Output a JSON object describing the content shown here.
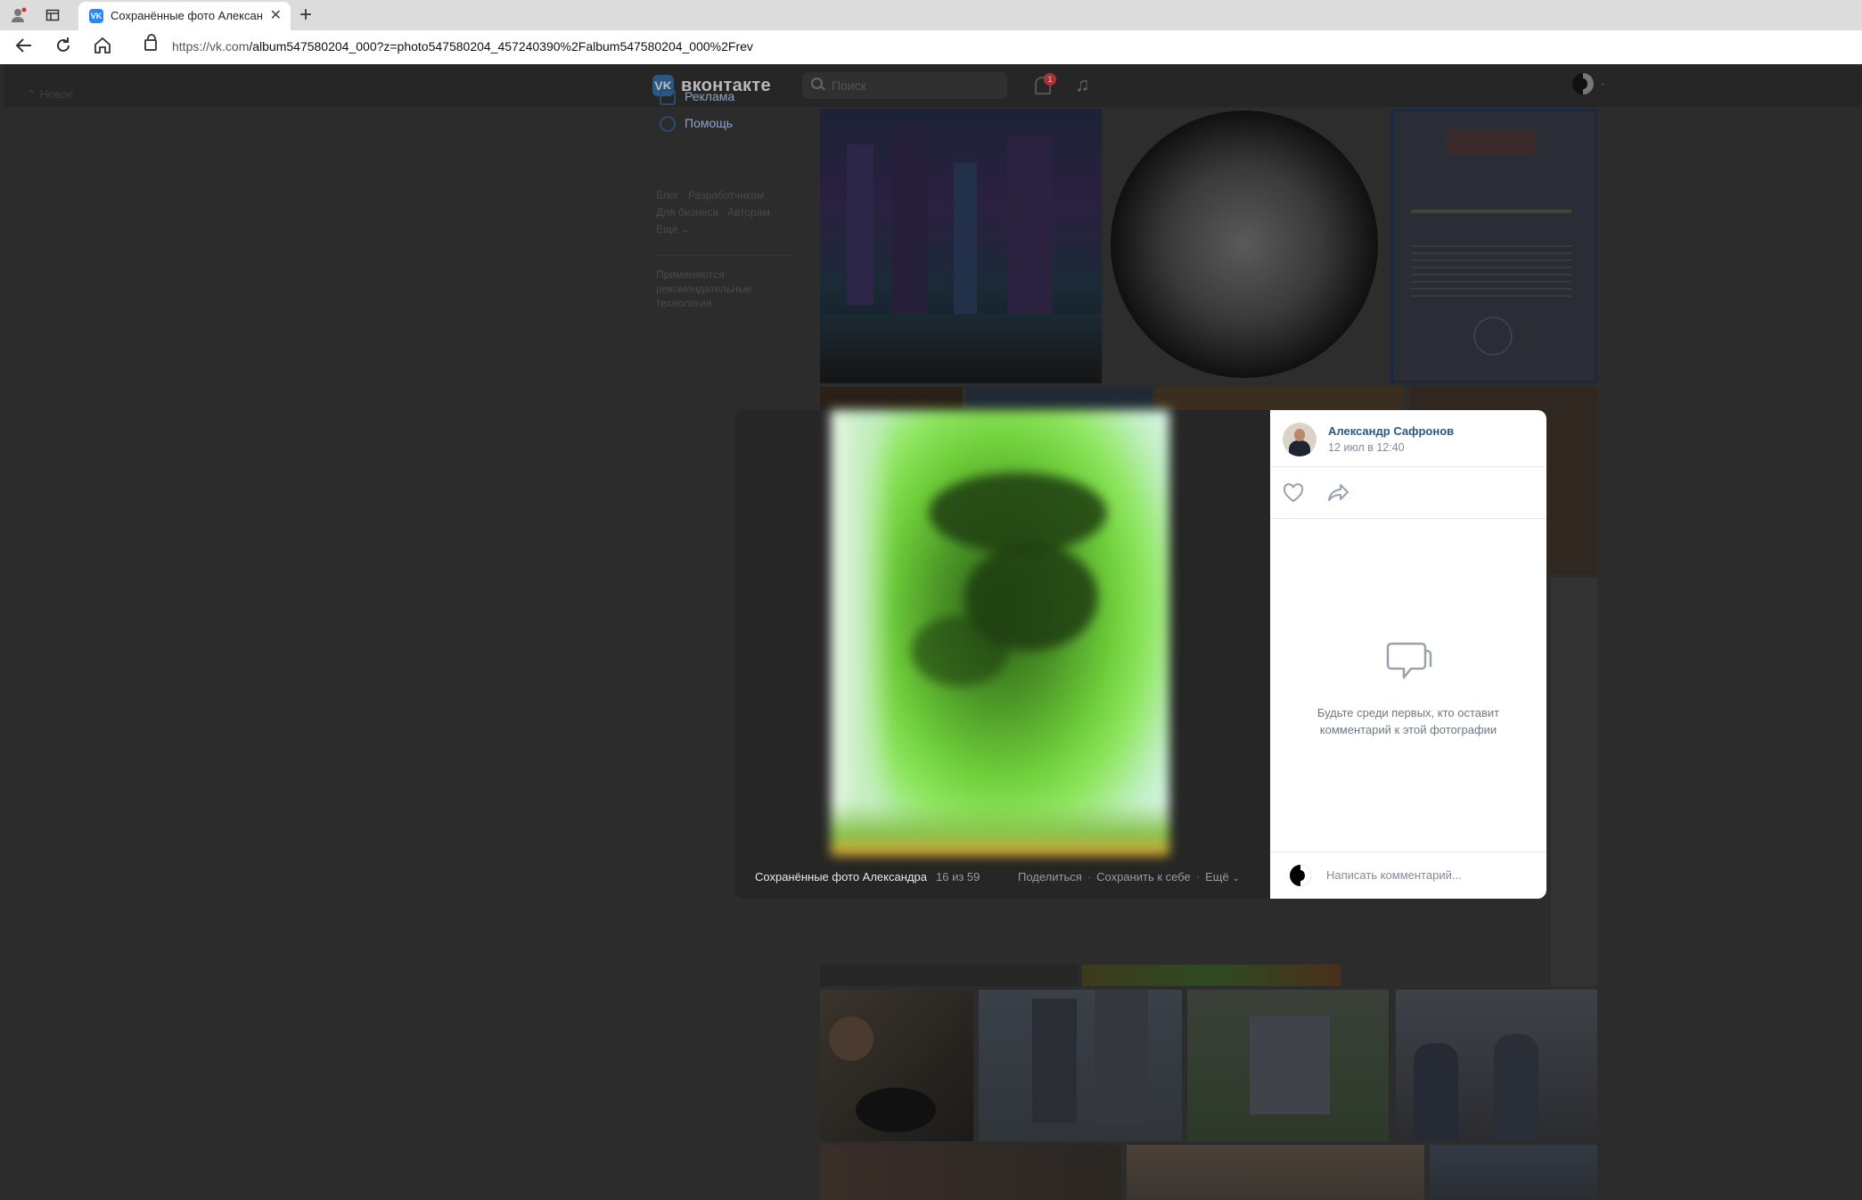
{
  "browser": {
    "tab_title": "Сохранённые фото Александра",
    "url_host": "https://vk.com",
    "url_path": "/album547580204_000?z=photo547580204_457240390%2Falbum547580204_000%2Frev"
  },
  "header": {
    "logo_mark": "VK",
    "logo_text": "вконтакте",
    "search_placeholder": "Поиск",
    "notification_count": "1"
  },
  "left": {
    "back_link": "Новое"
  },
  "sidebar": {
    "items": [
      {
        "label": "Реклама",
        "icon": "megaphone-icon"
      },
      {
        "label": "Помощь",
        "icon": "help-icon"
      }
    ],
    "footer_links": [
      "Блог",
      "Разработчикам",
      "Для бизнеса",
      "Авторам",
      "Ещё ⌄"
    ],
    "note": "Применяются рекомендательные технологии"
  },
  "viewer": {
    "album_title": "Сохранённые фото Александра",
    "counter": "16 из 59",
    "share_label": "Поделиться",
    "save_label": "Сохранить к себе",
    "more_label": "Ещё"
  },
  "panel": {
    "author": "Александр Сафронов",
    "date": "12 июл в 12:40",
    "empty_text": "Будьте среди первых, кто оставит комментарий к этой фотографии",
    "comment_placeholder": "Написать комментарий..."
  },
  "colors": {
    "link_blue": "#2a5885",
    "overlay_bg": "#2c2c2c",
    "panel_bg": "#ffffff",
    "muted_text": "#818c99"
  }
}
